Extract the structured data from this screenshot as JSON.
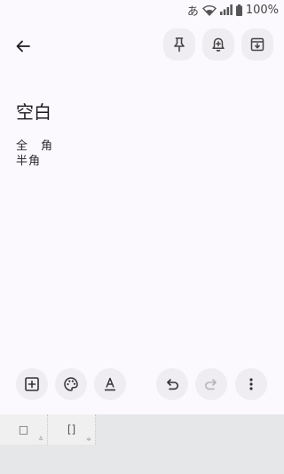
{
  "status_bar": {
    "ime_indicator": "あ",
    "wifi_icon": "wifi-icon",
    "signal_icon": "signal-icon",
    "battery_icon": "battery-icon",
    "battery_text": "100%"
  },
  "toolbar": {
    "back_icon": "arrow-back-icon",
    "pin_icon": "pin-icon",
    "reminder_icon": "bell-add-icon",
    "archive_icon": "archive-icon"
  },
  "note": {
    "title": "空白",
    "lines": [
      "全　角",
      "半角"
    ]
  },
  "bottom_toolbar": {
    "add_icon": "add-box-icon",
    "palette_icon": "palette-icon",
    "text_format_icon": "text-format-icon",
    "undo_icon": "undo-icon",
    "redo_icon": "redo-icon",
    "more_icon": "more-vert-icon"
  },
  "keyboard": {
    "keys": [
      {
        "label": "□",
        "sub": "≚"
      },
      {
        "label": "[]",
        "sub": "≑"
      }
    ]
  },
  "colors": {
    "background": "#fbf9fd",
    "button_bg": "#efedf2",
    "keyboard_bg": "#e6e7e8"
  }
}
